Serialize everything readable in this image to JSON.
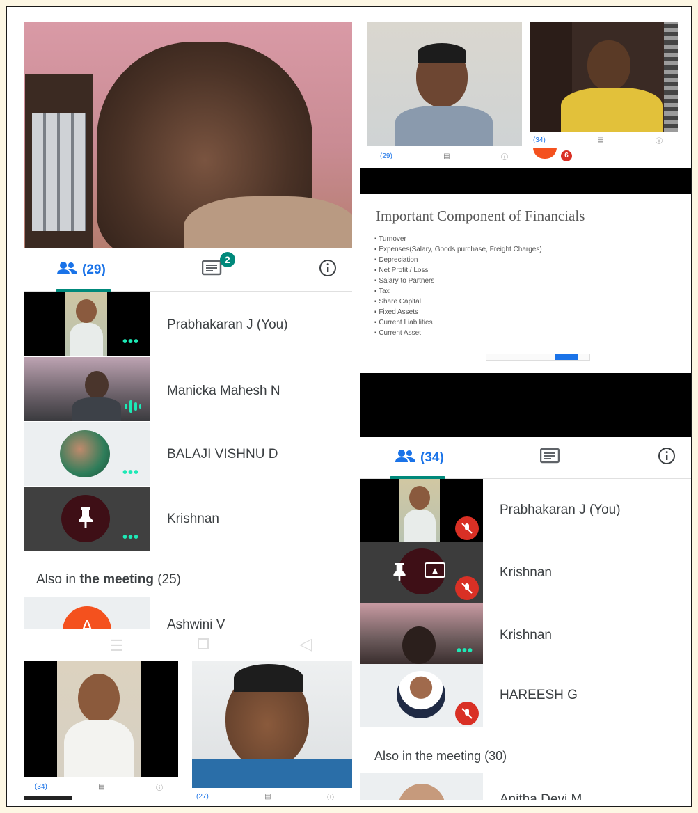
{
  "phone1": {
    "tabs": {
      "people_label": "(29)",
      "chat_badge": "2"
    },
    "participants": [
      {
        "name": "Prabhakaran J (You)"
      },
      {
        "name": "Manicka Mahesh N"
      },
      {
        "name": "BALAJI VISHNU D"
      },
      {
        "name": "Krishnan"
      }
    ],
    "also_in_meeting_prefix": "Also in ",
    "also_in_meeting_bold": "the meeting",
    "also_in_meeting_count": " (25)",
    "partial_name": "Ashwini V",
    "partial_avatar_letter": "A"
  },
  "mini_top_left": {
    "people_label": "(29)"
  },
  "mini_top_right": {
    "people_label": "(34)",
    "badge": "6"
  },
  "slide": {
    "title": "Important Component of Financials",
    "bullets": [
      "Turnover",
      "Expenses(Salary, Goods purchase, Freight Charges)",
      "Depreciation",
      "Net Profit / Loss",
      "Salary to Partners",
      "Tax",
      "Share Capital",
      "Fixed Assets",
      "Current Liabilities",
      "Current Asset"
    ]
  },
  "phone2": {
    "tabs": {
      "people_label": "(34)"
    },
    "participants": [
      {
        "name": "Prabhakaran J (You)"
      },
      {
        "name": "Krishnan"
      },
      {
        "name": "Krishnan"
      },
      {
        "name": "HAREESH G"
      }
    ],
    "also_in_meeting": "Also in the meeting (30)",
    "partial_name": "Anitha Devi M"
  },
  "mini_bottom_left": {
    "people_label": "(34)"
  },
  "mini_bottom_right": {
    "people_label": "(27)"
  },
  "colors": {
    "accent_teal": "#00897b",
    "blue": "#1a73e8",
    "mute_red": "#d93025",
    "dots": "#1de9b6"
  }
}
